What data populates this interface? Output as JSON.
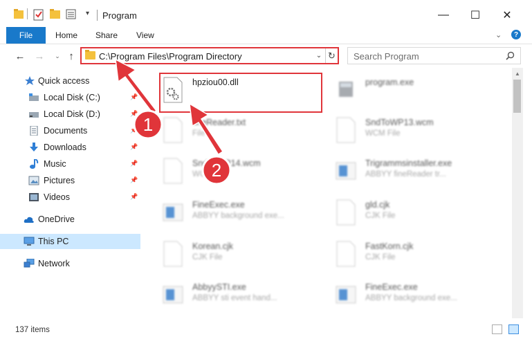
{
  "window": {
    "title": "Program",
    "minimize_glyph": "—",
    "maximize_glyph": "☐",
    "close_glyph": "✕"
  },
  "ribbon": {
    "file_tab": "File",
    "tabs": [
      "Home",
      "Share",
      "View"
    ],
    "help_glyph": "?"
  },
  "nav": {
    "address": "C:\\Program Files\\Program Directory",
    "search_placeholder": "Search Program"
  },
  "sidebar": {
    "items": [
      {
        "label": "Quick access",
        "icon": "star-icon"
      },
      {
        "label": "Local Disk (C:)",
        "icon": "drive-c-icon"
      },
      {
        "label": "Local Disk (D:)",
        "icon": "drive-d-icon"
      },
      {
        "label": "Documents",
        "icon": "documents-icon"
      },
      {
        "label": "Downloads",
        "icon": "download-icon"
      },
      {
        "label": "Music",
        "icon": "music-icon"
      },
      {
        "label": "Pictures",
        "icon": "pictures-icon"
      },
      {
        "label": "Videos",
        "icon": "videos-icon"
      },
      {
        "label": "OneDrive",
        "icon": "cloud-icon"
      },
      {
        "label": "This PC",
        "icon": "computer-icon"
      },
      {
        "label": "Network",
        "icon": "network-icon"
      }
    ]
  },
  "files": [
    {
      "name": "hpziou00.dll",
      "type": "",
      "icon": "dll-gear-icon"
    },
    {
      "name": "program.exe",
      "type": "",
      "icon": "exe-icon"
    },
    {
      "name": "fineReader.txt",
      "type": "File",
      "icon": "file-icon"
    },
    {
      "name": "SndToWP13.wcm",
      "type": "WCM File",
      "icon": "file-icon"
    },
    {
      "name": "SndToWP14.wcm",
      "type": "WCM File",
      "icon": "file-icon"
    },
    {
      "name": "Trigrammsinstaller.exe",
      "type": "ABBYY fineReader tr...",
      "icon": "app-icon"
    },
    {
      "name": "FineExec.exe",
      "type": "ABBYY background exe...",
      "icon": "app-icon"
    },
    {
      "name": "gld.cjk",
      "type": "CJK File",
      "icon": "file-icon"
    },
    {
      "name": "Korean.cjk",
      "type": "CJK File",
      "icon": "file-icon"
    },
    {
      "name": "FastKorn.cjk",
      "type": "CJK File",
      "icon": "file-icon"
    },
    {
      "name": "AbbyySTI.exe",
      "type": "ABBYY sti event hand...",
      "icon": "app-icon"
    },
    {
      "name": "FineExec.exe",
      "type": "ABBYY background exe...",
      "icon": "app-icon"
    }
  ],
  "annotations": {
    "step1": "1",
    "step2": "2",
    "color": "#e0353a"
  },
  "status": {
    "item_count": "137 items"
  },
  "colors": {
    "accent": "#1979ca",
    "selection": "#cce8ff",
    "highlight": "#e0353a"
  }
}
